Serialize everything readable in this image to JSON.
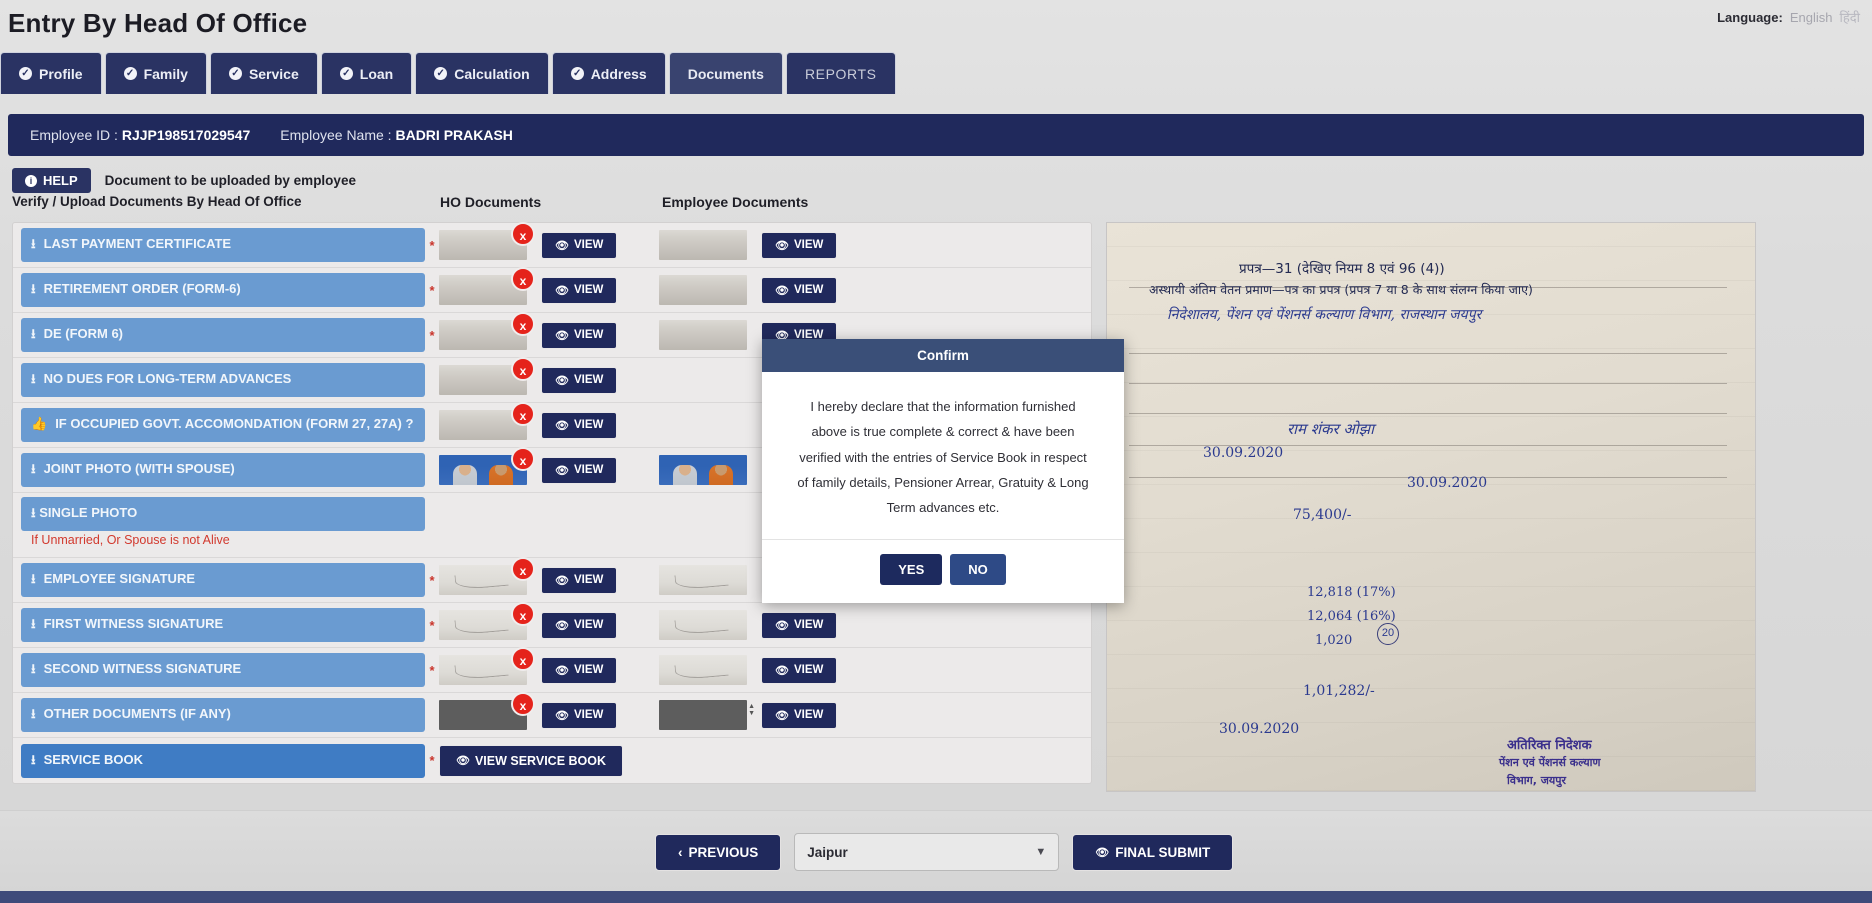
{
  "header": {
    "title": "Entry By Head Of Office",
    "language_label": "Language:",
    "language_current": "English",
    "language_alt": "हिंदी"
  },
  "tabs": [
    {
      "label": "Profile",
      "checked": true,
      "active": false
    },
    {
      "label": "Family",
      "checked": true,
      "active": false
    },
    {
      "label": "Service",
      "checked": true,
      "active": false
    },
    {
      "label": "Loan",
      "checked": true,
      "active": false
    },
    {
      "label": "Calculation",
      "checked": true,
      "active": false
    },
    {
      "label": "Address",
      "checked": true,
      "active": false
    },
    {
      "label": "Documents",
      "checked": false,
      "active": true
    },
    {
      "label": "REPORTS",
      "checked": false,
      "active": false
    }
  ],
  "employee": {
    "id_label": "Employee ID :",
    "id_value": "RJJP198517029547",
    "name_label": "Employee Name :",
    "name_value": "BADRI PRAKASH"
  },
  "help": {
    "button_label": "HELP",
    "note": "Document to be uploaded by employee",
    "subtitle": "Verify / Upload Documents By Head Of Office"
  },
  "columns": {
    "ho": "HO Documents",
    "employee": "Employee Documents"
  },
  "common": {
    "view_label": "VIEW",
    "view_service_book_label": "VIEW SERVICE BOOK",
    "required_mark": "*",
    "remove_mark": "x"
  },
  "rows": [
    {
      "label": "LAST PAYMENT CERTIFICATE",
      "required": true,
      "ho_thumb": "paper",
      "ho_remove": true,
      "ho_view": true,
      "emp_thumb": "paper",
      "emp_view": true
    },
    {
      "label": "RETIREMENT ORDER (FORM-6)",
      "required": true,
      "ho_thumb": "paper",
      "ho_remove": true,
      "ho_view": true,
      "emp_thumb": "paper",
      "emp_view": true
    },
    {
      "label": "DE (FORM 6)",
      "required": true,
      "ho_thumb": "paper",
      "ho_remove": true,
      "ho_view": true,
      "emp_thumb": "paper",
      "emp_view": true
    },
    {
      "label": "NO DUES FOR LONG-TERM ADVANCES",
      "required": false,
      "ho_thumb": "paper",
      "ho_remove": true,
      "ho_view": true,
      "emp_thumb": "blank",
      "emp_view": false
    },
    {
      "label": "IF OCCUPIED GOVT. ACCOMONDATION (FORM 27, 27A) ?",
      "required": false,
      "ho_thumb": "paper",
      "ho_remove": true,
      "ho_view": true,
      "emp_thumb": "blank",
      "emp_view": false,
      "icon": "thumbs-up"
    },
    {
      "label": "JOINT PHOTO (WITH SPOUSE)",
      "required": false,
      "ho_thumb": "photo",
      "ho_remove": true,
      "ho_view": true,
      "emp_thumb": "photo",
      "emp_view": false
    },
    {
      "label": "SINGLE PHOTO",
      "required": false,
      "ho_thumb": "blank",
      "ho_remove": false,
      "ho_view": false,
      "emp_thumb": "blank",
      "emp_view": false,
      "note": "If Unmarried, Or Spouse is not Alive"
    },
    {
      "label": "EMPLOYEE SIGNATURE",
      "required": true,
      "ho_thumb": "sign",
      "ho_remove": true,
      "ho_view": true,
      "emp_thumb": "sign",
      "emp_view": true
    },
    {
      "label": "FIRST WITNESS SIGNATURE",
      "required": true,
      "ho_thumb": "sign",
      "ho_remove": true,
      "ho_view": true,
      "emp_thumb": "sign",
      "emp_view": true
    },
    {
      "label": "SECOND WITNESS SIGNATURE",
      "required": true,
      "ho_thumb": "sign",
      "ho_remove": true,
      "ho_view": true,
      "emp_thumb": "sign",
      "emp_view": true
    },
    {
      "label": "OTHER DOCUMENTS (IF ANY)",
      "required": false,
      "ho_thumb": "dark",
      "ho_remove": true,
      "ho_view": true,
      "emp_thumb": "dark",
      "emp_view": true,
      "emp_spinner": true
    },
    {
      "label": "SERVICE BOOK",
      "required": true,
      "ho_thumb": "none",
      "ho_remove": false,
      "ho_view": false,
      "service_book_button": true,
      "emp_thumb": "blank",
      "emp_view": false
    }
  ],
  "preview": {
    "alt": "scanned-service-book-page",
    "lines": [
      "प्रपत्र—31 (देखिए नियम 8 एवं 96 (4))",
      "अस्थायी अंतिम वेतन प्रमाण—पत्र का प्रपत्र (प्रपत्र 7 या 8 के साथ संलग्न किया जाए)",
      "निदेशालय, पेंशन एवं पेंशनर्स कल्याण विभाग, राजस्थान जयपुर"
    ],
    "entries": [
      {
        "text": "राम शंकर ओझा"
      },
      {
        "text": "30.09.2020"
      },
      {
        "text": "30.09.2020"
      },
      {
        "text": "75,400/-"
      },
      {
        "text": "12,818  (17%)"
      },
      {
        "text": "12,064  (16%)"
      },
      {
        "text": "1,020"
      },
      {
        "text": "1,01,282/-"
      },
      {
        "text": "30.09.2020"
      }
    ],
    "stamp_lines": [
      "अतिरिक्त निदेशक",
      "पेंशन एवं पेंशनर्स कल्याण",
      "विभाग, जयपुर"
    ],
    "page_number": "20"
  },
  "modal": {
    "title": "Confirm",
    "message": "I hereby declare that the information furnished above is true complete & correct & have been verified with the entries of Service Book in respect of family details, Pensioner Arrear, Gratuity & Long Term advances etc.",
    "yes_label": "YES",
    "no_label": "NO"
  },
  "footer": {
    "previous_label": "PREVIOUS",
    "district_value": "Jaipur",
    "final_submit_label": "FINAL SUBMIT"
  },
  "colors": {
    "navy": "#20295c",
    "tab_navy": "#2a3363",
    "row_blue": "#6a9bd1",
    "danger": "#e5231b",
    "note_red": "#d2392e"
  }
}
